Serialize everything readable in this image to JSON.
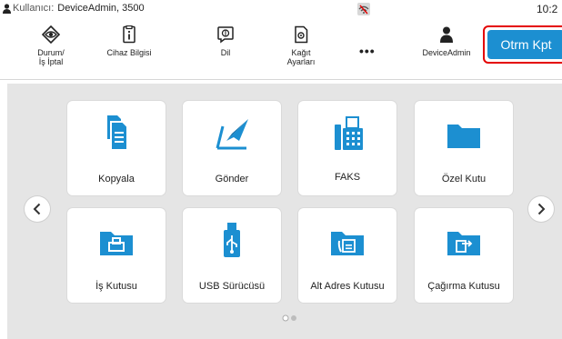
{
  "status_bar": {
    "user_label": "Kullanıcı:",
    "user_value": "DeviceAdmin, 3500",
    "time": "10:2"
  },
  "toolbar": {
    "status_cancel": "Durum/\nİş İptal",
    "device_info": "Cihaz Bilgisi",
    "language": "Dil",
    "paper_settings": "Kağıt\nAyarları",
    "more": "•••",
    "user": "DeviceAdmin",
    "logout": "Otrm Kpt"
  },
  "tiles": [
    {
      "label": "Kopyala",
      "icon": "copy-icon"
    },
    {
      "label": "Gönder",
      "icon": "send-icon"
    },
    {
      "label": "FAKS",
      "icon": "fax-icon"
    },
    {
      "label": "Özel Kutu",
      "icon": "custom-box-icon"
    },
    {
      "label": "İş Kutusu",
      "icon": "job-box-icon"
    },
    {
      "label": "USB Sürücüsü",
      "icon": "usb-drive-icon"
    },
    {
      "label": "Alt Adres Kutusu",
      "icon": "sub-address-box-icon"
    },
    {
      "label": "Çağırma Kutusu",
      "icon": "polling-box-icon"
    }
  ],
  "pagination": {
    "current": 1,
    "total": 2
  },
  "colors": {
    "accent": "#1c8fd1",
    "highlight": "#e40000",
    "background": "#e5e5e5"
  }
}
